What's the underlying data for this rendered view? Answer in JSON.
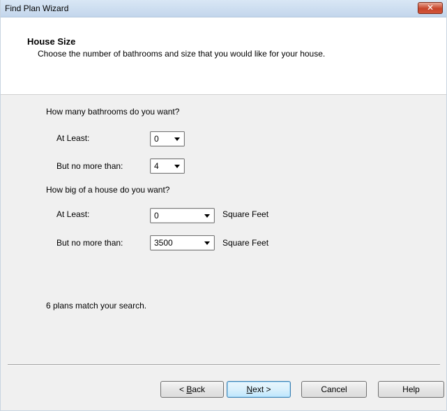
{
  "window": {
    "title": "Find Plan Wizard",
    "close_label": "✕"
  },
  "header": {
    "title": "House Size",
    "subtitle": "Choose the number of bathrooms and size that you would like for your house."
  },
  "bathrooms": {
    "question": "How many bathrooms do you want?",
    "at_least_label": "At Least:",
    "at_least_value": "0",
    "no_more_label": "But no more than:",
    "no_more_value": "4"
  },
  "size": {
    "question": "How big of a house do you want?",
    "at_least_label": "At Least:",
    "at_least_value": "0",
    "no_more_label": "But no more than:",
    "no_more_value": "3500",
    "unit": "Square Feet"
  },
  "status": "6 plans match your search.",
  "buttons": {
    "back_prefix": "< ",
    "back_accel": "B",
    "back_rest": "ack",
    "next_accel": "N",
    "next_rest": "ext >",
    "cancel": "Cancel",
    "help": "Help"
  }
}
